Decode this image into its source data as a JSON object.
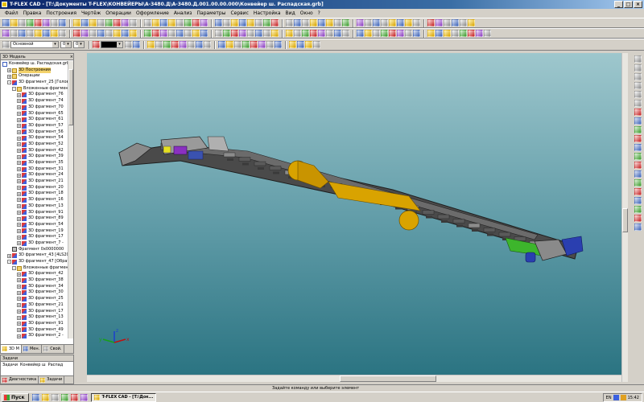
{
  "window": {
    "title": "T-FLEX CAD - [T:\\Документы T-FLEX\\КОНВЕЙЕРЫ\\A-3480.Д\\A-3480.Д.001.00.00.000\\Конвейер ш. Распадская.grb]",
    "min_label": "_",
    "max_label": "□",
    "close_label": "×"
  },
  "menu": {
    "items": [
      "Файл",
      "Правка",
      "Построения",
      "Чертёж",
      "Операции",
      "Оформление",
      "Анализ",
      "Параметры",
      "Сервис",
      "Настройка",
      "Вид",
      "Окно",
      "?"
    ]
  },
  "toolbar3": {
    "layer_value": "Основной",
    "width_value": "0",
    "count_value": "0"
  },
  "model_panel": {
    "title": "3D Модель",
    "close_label": "×",
    "tree": [
      {
        "label": "Конвейер ш. Распадская.grb",
        "level": 0,
        "exp": "",
        "icon": "doc"
      },
      {
        "label": "3D Построения",
        "level": 1,
        "exp": "+",
        "icon": "folder",
        "selected": true
      },
      {
        "label": "Операции",
        "level": 1,
        "exp": "+",
        "icon": "folder"
      },
      {
        "label": "3D фрагмент_25 [Головн",
        "level": 1,
        "exp": "-",
        "icon": "part"
      },
      {
        "label": "Вложенные фрагмен",
        "level": 2,
        "exp": "-",
        "icon": "folder"
      },
      {
        "label": "3D фрагмент_76",
        "level": 3,
        "exp": "+",
        "icon": "part"
      },
      {
        "label": "3D фрагмент_74",
        "level": 3,
        "exp": "+",
        "icon": "part"
      },
      {
        "label": "3D фрагмент_70",
        "level": 3,
        "exp": "+",
        "icon": "part"
      },
      {
        "label": "3D фрагмент_65",
        "level": 3,
        "exp": "+",
        "icon": "part"
      },
      {
        "label": "3D фрагмент_61",
        "level": 3,
        "exp": "+",
        "icon": "part"
      },
      {
        "label": "3D фрагмент_57",
        "level": 3,
        "exp": "+",
        "icon": "part"
      },
      {
        "label": "3D фрагмент_56",
        "level": 3,
        "exp": "+",
        "icon": "part"
      },
      {
        "label": "3D фрагмент_54",
        "level": 3,
        "exp": "+",
        "icon": "part"
      },
      {
        "label": "3D фрагмент_52",
        "level": 3,
        "exp": "+",
        "icon": "part"
      },
      {
        "label": "3D фрагмент_42",
        "level": 3,
        "exp": "+",
        "icon": "part"
      },
      {
        "label": "3D фрагмент_39",
        "level": 3,
        "exp": "+",
        "icon": "part"
      },
      {
        "label": "3D фрагмент_35",
        "level": 3,
        "exp": "+",
        "icon": "part"
      },
      {
        "label": "3D фрагмент_31",
        "level": 3,
        "exp": "+",
        "icon": "part"
      },
      {
        "label": "3D фрагмент_24",
        "level": 3,
        "exp": "+",
        "icon": "part"
      },
      {
        "label": "3D фрагмент_21",
        "level": 3,
        "exp": "+",
        "icon": "part"
      },
      {
        "label": "3D фрагмент_20",
        "level": 3,
        "exp": "+",
        "icon": "part"
      },
      {
        "label": "3D фрагмент_18",
        "level": 3,
        "exp": "+",
        "icon": "part"
      },
      {
        "label": "3D фрагмент_16",
        "level": 3,
        "exp": "+",
        "icon": "part"
      },
      {
        "label": "3D фрагмент_13",
        "level": 3,
        "exp": "+",
        "icon": "part"
      },
      {
        "label": "3D фрагмент_91",
        "level": 3,
        "exp": "+",
        "icon": "part"
      },
      {
        "label": "3D фрагмент_89",
        "level": 3,
        "exp": "+",
        "icon": "part"
      },
      {
        "label": "3D фрагмент_54",
        "level": 3,
        "exp": "+",
        "icon": "part"
      },
      {
        "label": "3D фрагмент_19",
        "level": 3,
        "exp": "+",
        "icon": "part"
      },
      {
        "label": "3D фрагмент_17",
        "level": 3,
        "exp": "+",
        "icon": "part"
      },
      {
        "label": "3D фрагмент_7 -",
        "level": 3,
        "exp": "+",
        "icon": "part"
      },
      {
        "label": "Фрагмент 0x0000000",
        "level": 2,
        "exp": "",
        "icon": "frag"
      },
      {
        "label": "3D фрагмент_43 [4LS20",
        "level": 1,
        "exp": "+",
        "icon": "part"
      },
      {
        "label": "3D фрагмент_47 [Обратн",
        "level": 1,
        "exp": "-",
        "icon": "part"
      },
      {
        "label": "Вложенные фрагмен",
        "level": 2,
        "exp": "-",
        "icon": "folder"
      },
      {
        "label": "3D фрагмент_42",
        "level": 3,
        "exp": "+",
        "icon": "part"
      },
      {
        "label": "3D фрагмент_38",
        "level": 3,
        "exp": "+",
        "icon": "part"
      },
      {
        "label": "3D фрагмент_34",
        "level": 3,
        "exp": "+",
        "icon": "part"
      },
      {
        "label": "3D фрагмент_30",
        "level": 3,
        "exp": "+",
        "icon": "part"
      },
      {
        "label": "3D фрагмент_25",
        "level": 3,
        "exp": "+",
        "icon": "part"
      },
      {
        "label": "3D фрагмент_21",
        "level": 3,
        "exp": "+",
        "icon": "part"
      },
      {
        "label": "3D фрагмент_17",
        "level": 3,
        "exp": "+",
        "icon": "part"
      },
      {
        "label": "3D фрагмент_13",
        "level": 3,
        "exp": "+",
        "icon": "part"
      },
      {
        "label": "3D фрагмент_91",
        "level": 3,
        "exp": "+",
        "icon": "part"
      },
      {
        "label": "3D фрагмент_49",
        "level": 3,
        "exp": "+",
        "icon": "part"
      },
      {
        "label": "3D фрагмент_2 -",
        "level": 3,
        "exp": "+",
        "icon": "part"
      }
    ],
    "tabs": [
      "3D М",
      "Мен.",
      "Свой."
    ]
  },
  "task_panel": {
    "title": "Задачи",
    "row_items": [
      "Задачи",
      "Конвейер ш",
      "Распад"
    ],
    "tabs": [
      "Диагностика",
      "Задачи"
    ]
  },
  "viewport": {
    "axis_x": "x",
    "axis_y": "y",
    "axis_z": "z",
    "colors": {
      "sky_top": "#9ec7cd",
      "sky_bottom": "#2b7482",
      "frame": "#3c3c3c",
      "roller": "#d9a300",
      "green": "#3db52c",
      "blue": "#2a3fb0",
      "purple": "#8a30c0"
    }
  },
  "status": {
    "text": "Задайте команду или выберите элемент"
  },
  "taskbar": {
    "start_label": "Пуск",
    "task_label": "T-FLEX CAD - [T:\\Док...",
    "lang": "EN",
    "clock": "15:42"
  }
}
